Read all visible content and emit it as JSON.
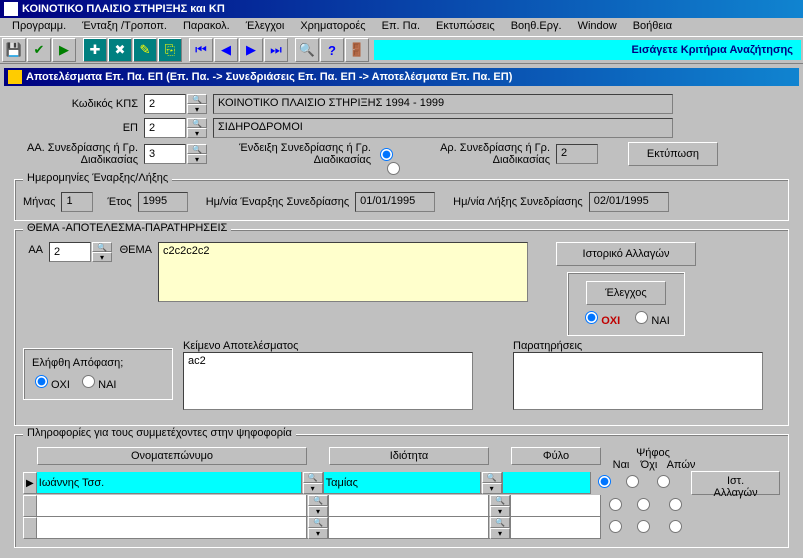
{
  "app_title": "ΚΟΙΝΟΤΙΚΟ ΠΛΑΙΣΙΟ ΣΤΗΡΙΞΗΣ και ΚΠ",
  "menu": {
    "prog": "Προγραμμ.",
    "entaxi": "Ένταξη /Τροποπ.",
    "parakol": "Παρακολ.",
    "elegxoi": "Έλεγχοι",
    "xrim": "Χρηματοροές",
    "eppa": "Επ. Πα.",
    "ektyp": "Εκτυπώσεις",
    "voith": "Βοηθ.Εργ.",
    "window": "Window",
    "help": "Βοήθεια"
  },
  "search_hint": "Εισάγετε Κριτήρια Αναζήτησης",
  "child_title": "Αποτελέσματα Επ. Πα. ΕΠ (Επ. Πα. -> Συνεδριάσεις Επ. Πα. ΕΠ -> Αποτελέσματα Επ. Πα. ΕΠ)",
  "labels": {
    "kps": "Κωδικός ΚΠΣ",
    "ep": "ΕΠ",
    "aa_syn": "ΑΑ. Συνεδρίασης ή Γρ. Διαδικασίας",
    "endeixi": "Ένδειξη Συνεδρίασης ή Γρ. Διαδικασίας",
    "ar_syn": "Αρ. Συνεδρίασης ή Γρ. Διαδικασίας",
    "dates_legend": "Ημερομηνίες Έναρξης/Λήξης",
    "minas": "Μήνας",
    "etos": "Έτος",
    "hm_enarx": "Ημ/νία Έναρξης Συνεδρίασης",
    "hm_lix": "Ημ/νία Λήξης Συνεδρίασης",
    "thema_legend": "ΘΕΜΑ -ΑΠΟΤΕΛΕΣΜΑ-ΠΑΡΑΤΗΡΗΣΕΙΣ",
    "aa": "ΑΑ",
    "thema": "ΘΕΜΑ",
    "istoriko": "Ιστορικό Αλλαγών",
    "elegxos": "Έλεγχος",
    "keimeno": "Κείμενο Αποτελέσματος",
    "paratiriseis": "Παρατηρήσεις",
    "elifthi": "Ελήφθη Απόφαση;",
    "oxi": "ΟΧΙ",
    "nai": "ΝΑΙ",
    "pliro_legend": "Πληροφορίες για τους συμμετέχοντες στην ψηφοφορία",
    "onomat": "Ονοματεπώνυμο",
    "idiotita": "Ιδιότητα",
    "fylo": "Φύλο",
    "psifos": "Ψήφος",
    "psif_nai": "Ναι",
    "psif_oxi": "Όχι",
    "psif_apon": "Απών",
    "ist_allagon": "Ιστ. Αλλαγών",
    "ektyposi": "Εκτύπωση"
  },
  "fields": {
    "kps_code": "2",
    "kps_desc": "ΚΟΙΝΟΤΙΚΟ ΠΛΑΙΣΙΟ ΣΤΗΡΙΞΗΣ 1994 - 1999",
    "ep_code": "2",
    "ep_desc": "ΣΙΔΗΡΟΔΡΟΜΟΙ",
    "aa_syn": "3",
    "ar_syn": "2",
    "minas": "1",
    "etos": "1995",
    "hm_enarx": "01/01/1995",
    "hm_lix": "02/01/1995",
    "aa": "2",
    "thema": "c2c2c2c2",
    "keimeno": "ac2",
    "paratiriseis": ""
  },
  "participants": [
    {
      "name": "Ιωάννης Τσσ.",
      "role": "Ταμίας",
      "gender": "",
      "vote": "nai"
    }
  ]
}
